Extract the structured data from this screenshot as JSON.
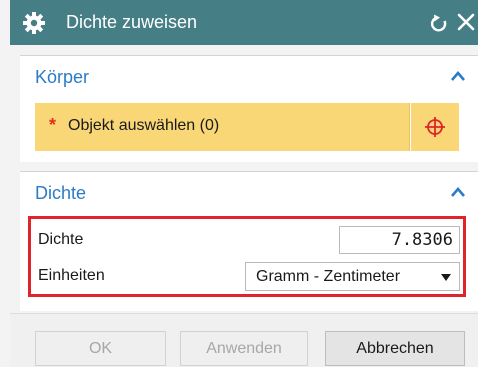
{
  "window": {
    "title": "Dichte zuweisen",
    "icons": {
      "settings": "gear-icon",
      "reset": "reset-icon",
      "close": "close-icon"
    },
    "title_bar_color": "#467e86"
  },
  "sections": {
    "koerper": {
      "title": "Körper",
      "collapse_icon": "chevron-up-icon",
      "select_object": {
        "required_marker": "*",
        "label": "Objekt auswählen (0)"
      },
      "pick_icon": "crosshair-icon"
    },
    "dichte": {
      "title": "Dichte",
      "collapse_icon": "chevron-up-icon",
      "density": {
        "label": "Dichte",
        "value": "7.8306"
      },
      "units": {
        "label": "Einheiten",
        "value": "Gramm - Zentimeter"
      }
    }
  },
  "buttons": {
    "ok": "OK",
    "apply": "Anwenden",
    "cancel": "Abbrechen"
  },
  "colors": {
    "section_title": "#2a7cc7",
    "selection_highlight": "#f9d776",
    "required_marker": "#e03020",
    "focus_outline": "#e0242c"
  }
}
